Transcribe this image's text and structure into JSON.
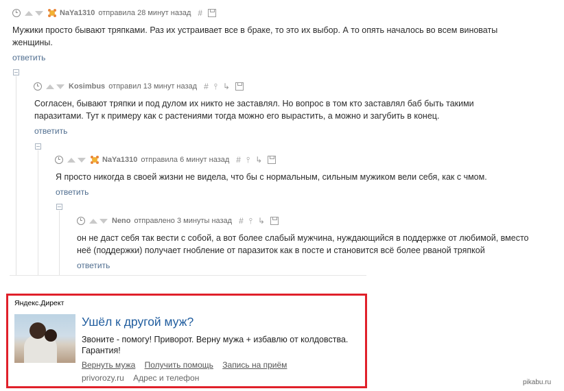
{
  "comments": [
    {
      "user": "NaYa1310",
      "verb_time": "отправила 28 минут назад",
      "hash": "#",
      "text": "Мужики просто бывают тряпками. Раз их устраивает все в браке, то это их выбор. А то опять началось во всем виноваты женщины.",
      "reply": "ответить"
    },
    {
      "user": "Kosimbus",
      "verb_time": "отправил 13 минут назад",
      "hash": "#",
      "text": "Согласен, бывают тряпки и под дулом их никто не заставлял. Но вопрос в том кто заставлял баб быть такими паразитами. Тут к примеру как с растениями тогда можно его вырастить, а можно и загубить в конец.",
      "reply": "ответить"
    },
    {
      "user": "NaYa1310",
      "verb_time": "отправила 6 минут назад",
      "hash": "#",
      "text": "Я просто никогда в своей жизни не видела, что бы с нормальным, сильным мужиком вели себя, как с чмом.",
      "reply": "ответить"
    },
    {
      "user": "Neno",
      "verb_time": "отправлено 3 минуты назад",
      "hash": "#",
      "text": "он не даст себя так вести с собой, а вот более слабый мужчина, нуждающийся в поддержке от любимой, вместо неё (поддержки) получает гнобление от паразиток как в посте и становится всё более рваной тряпкой",
      "reply": "ответить"
    }
  ],
  "icons": {
    "clock": "clock-icon",
    "upvote": "upvote-arrow-icon",
    "downvote": "downvote-arrow-icon",
    "pin": "pin-icon",
    "branch": "branch-icon",
    "save": "save-icon",
    "collapse": "collapse-thread-icon"
  },
  "ad": {
    "label": "Яндекс.Директ",
    "title": "Ушёл к другой муж?",
    "text": "Звоните - помогу! Приворот. Верну мужа + избавлю от колдовства. Гарантия!",
    "links": [
      "Вернуть мужа",
      "Получить помощь",
      "Запись на приём"
    ],
    "domain": "privorozy.ru",
    "contact": "Адрес и телефон",
    "border_color": "#e0202a",
    "title_color": "#1f5c9e"
  },
  "watermark": "pikabu.ru"
}
